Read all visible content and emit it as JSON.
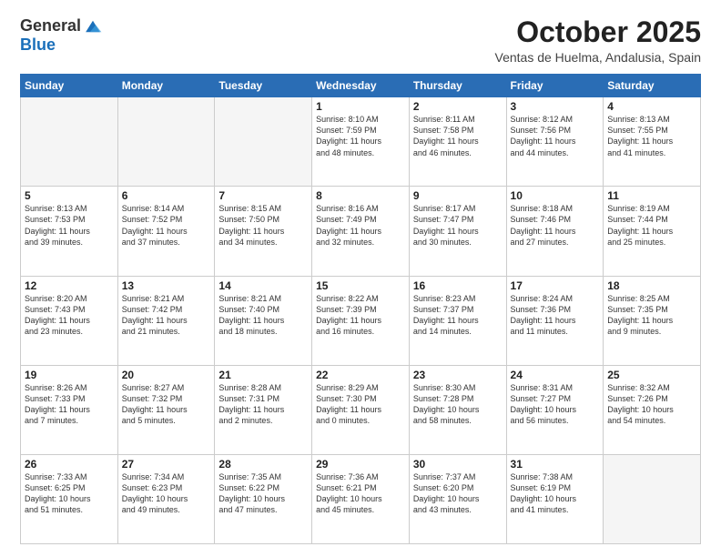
{
  "logo": {
    "general": "General",
    "blue": "Blue"
  },
  "title": "October 2025",
  "location": "Ventas de Huelma, Andalusia, Spain",
  "weekdays": [
    "Sunday",
    "Monday",
    "Tuesday",
    "Wednesday",
    "Thursday",
    "Friday",
    "Saturday"
  ],
  "weeks": [
    [
      {
        "day": "",
        "info": ""
      },
      {
        "day": "",
        "info": ""
      },
      {
        "day": "",
        "info": ""
      },
      {
        "day": "1",
        "info": "Sunrise: 8:10 AM\nSunset: 7:59 PM\nDaylight: 11 hours\nand 48 minutes."
      },
      {
        "day": "2",
        "info": "Sunrise: 8:11 AM\nSunset: 7:58 PM\nDaylight: 11 hours\nand 46 minutes."
      },
      {
        "day": "3",
        "info": "Sunrise: 8:12 AM\nSunset: 7:56 PM\nDaylight: 11 hours\nand 44 minutes."
      },
      {
        "day": "4",
        "info": "Sunrise: 8:13 AM\nSunset: 7:55 PM\nDaylight: 11 hours\nand 41 minutes."
      }
    ],
    [
      {
        "day": "5",
        "info": "Sunrise: 8:13 AM\nSunset: 7:53 PM\nDaylight: 11 hours\nand 39 minutes."
      },
      {
        "day": "6",
        "info": "Sunrise: 8:14 AM\nSunset: 7:52 PM\nDaylight: 11 hours\nand 37 minutes."
      },
      {
        "day": "7",
        "info": "Sunrise: 8:15 AM\nSunset: 7:50 PM\nDaylight: 11 hours\nand 34 minutes."
      },
      {
        "day": "8",
        "info": "Sunrise: 8:16 AM\nSunset: 7:49 PM\nDaylight: 11 hours\nand 32 minutes."
      },
      {
        "day": "9",
        "info": "Sunrise: 8:17 AM\nSunset: 7:47 PM\nDaylight: 11 hours\nand 30 minutes."
      },
      {
        "day": "10",
        "info": "Sunrise: 8:18 AM\nSunset: 7:46 PM\nDaylight: 11 hours\nand 27 minutes."
      },
      {
        "day": "11",
        "info": "Sunrise: 8:19 AM\nSunset: 7:44 PM\nDaylight: 11 hours\nand 25 minutes."
      }
    ],
    [
      {
        "day": "12",
        "info": "Sunrise: 8:20 AM\nSunset: 7:43 PM\nDaylight: 11 hours\nand 23 minutes."
      },
      {
        "day": "13",
        "info": "Sunrise: 8:21 AM\nSunset: 7:42 PM\nDaylight: 11 hours\nand 21 minutes."
      },
      {
        "day": "14",
        "info": "Sunrise: 8:21 AM\nSunset: 7:40 PM\nDaylight: 11 hours\nand 18 minutes."
      },
      {
        "day": "15",
        "info": "Sunrise: 8:22 AM\nSunset: 7:39 PM\nDaylight: 11 hours\nand 16 minutes."
      },
      {
        "day": "16",
        "info": "Sunrise: 8:23 AM\nSunset: 7:37 PM\nDaylight: 11 hours\nand 14 minutes."
      },
      {
        "day": "17",
        "info": "Sunrise: 8:24 AM\nSunset: 7:36 PM\nDaylight: 11 hours\nand 11 minutes."
      },
      {
        "day": "18",
        "info": "Sunrise: 8:25 AM\nSunset: 7:35 PM\nDaylight: 11 hours\nand 9 minutes."
      }
    ],
    [
      {
        "day": "19",
        "info": "Sunrise: 8:26 AM\nSunset: 7:33 PM\nDaylight: 11 hours\nand 7 minutes."
      },
      {
        "day": "20",
        "info": "Sunrise: 8:27 AM\nSunset: 7:32 PM\nDaylight: 11 hours\nand 5 minutes."
      },
      {
        "day": "21",
        "info": "Sunrise: 8:28 AM\nSunset: 7:31 PM\nDaylight: 11 hours\nand 2 minutes."
      },
      {
        "day": "22",
        "info": "Sunrise: 8:29 AM\nSunset: 7:30 PM\nDaylight: 11 hours\nand 0 minutes."
      },
      {
        "day": "23",
        "info": "Sunrise: 8:30 AM\nSunset: 7:28 PM\nDaylight: 10 hours\nand 58 minutes."
      },
      {
        "day": "24",
        "info": "Sunrise: 8:31 AM\nSunset: 7:27 PM\nDaylight: 10 hours\nand 56 minutes."
      },
      {
        "day": "25",
        "info": "Sunrise: 8:32 AM\nSunset: 7:26 PM\nDaylight: 10 hours\nand 54 minutes."
      }
    ],
    [
      {
        "day": "26",
        "info": "Sunrise: 7:33 AM\nSunset: 6:25 PM\nDaylight: 10 hours\nand 51 minutes."
      },
      {
        "day": "27",
        "info": "Sunrise: 7:34 AM\nSunset: 6:23 PM\nDaylight: 10 hours\nand 49 minutes."
      },
      {
        "day": "28",
        "info": "Sunrise: 7:35 AM\nSunset: 6:22 PM\nDaylight: 10 hours\nand 47 minutes."
      },
      {
        "day": "29",
        "info": "Sunrise: 7:36 AM\nSunset: 6:21 PM\nDaylight: 10 hours\nand 45 minutes."
      },
      {
        "day": "30",
        "info": "Sunrise: 7:37 AM\nSunset: 6:20 PM\nDaylight: 10 hours\nand 43 minutes."
      },
      {
        "day": "31",
        "info": "Sunrise: 7:38 AM\nSunset: 6:19 PM\nDaylight: 10 hours\nand 41 minutes."
      },
      {
        "day": "",
        "info": ""
      }
    ]
  ]
}
